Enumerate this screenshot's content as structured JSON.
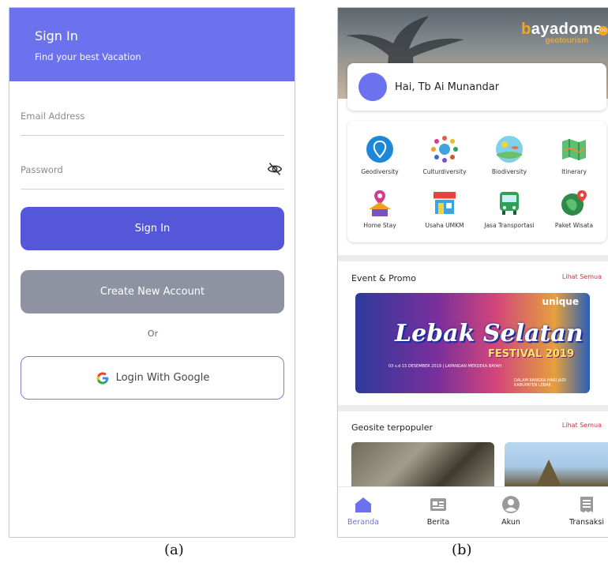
{
  "screen_a": {
    "header": {
      "title": "Sign In",
      "subtitle": "Find your best Vacation"
    },
    "email": {
      "placeholder": "Email Address"
    },
    "password": {
      "placeholder": "Password"
    },
    "signin_label": "Sign In",
    "create_label": "Create New Account",
    "or_label": "Or",
    "google_label": "Login With Google",
    "colors": {
      "header": "#6c72ee",
      "primary": "#5458d8",
      "secondary": "#8f93a1"
    }
  },
  "screen_b": {
    "brand": {
      "prefix": "b",
      "name": "ayadome",
      "sub": "geotourism"
    },
    "greeting": "Hai, Tb Ai Munandar",
    "categories": [
      {
        "label": "Geodiversity",
        "icon": "geodiversity-icon"
      },
      {
        "label": "Culturdiversity",
        "icon": "culturdiversity-icon"
      },
      {
        "label": "Biodiversity",
        "icon": "biodiversity-icon"
      },
      {
        "label": "Itinerary",
        "icon": "map-icon"
      },
      {
        "label": "Home Stay",
        "icon": "home-stay-icon"
      },
      {
        "label": "Usaha UMKM",
        "icon": "shop-icon"
      },
      {
        "label": "Jasa Transportasi",
        "icon": "bus-icon"
      },
      {
        "label": "Paket Wisata",
        "icon": "tour-package-icon"
      }
    ],
    "event": {
      "title": "Event & Promo",
      "more": "Lihat Semua",
      "banner": {
        "top": "unique",
        "headline": "Lebak Selatan",
        "festival": "FESTIVAL 2019",
        "dates": "03 s.d 15 DESEMBER 2019 | LAPANGAN MERDEKA BAYAH",
        "note": "DALAM RANGKA HARI JADI KABUPATEN LEBAK"
      }
    },
    "geosite": {
      "title": "Geosite terpopuler",
      "more": "Lihat Semua"
    },
    "nav": [
      {
        "label": "Beranda",
        "icon": "home-icon",
        "active": true
      },
      {
        "label": "Berita",
        "icon": "news-icon",
        "active": false
      },
      {
        "label": "Akun",
        "icon": "account-icon",
        "active": false
      },
      {
        "label": "Transaksi",
        "icon": "receipt-icon",
        "active": false
      }
    ],
    "colors": {
      "accent": "#6c72ee",
      "link": "#d1343d"
    }
  },
  "captions": {
    "a": "(a)",
    "b": "(b)"
  }
}
